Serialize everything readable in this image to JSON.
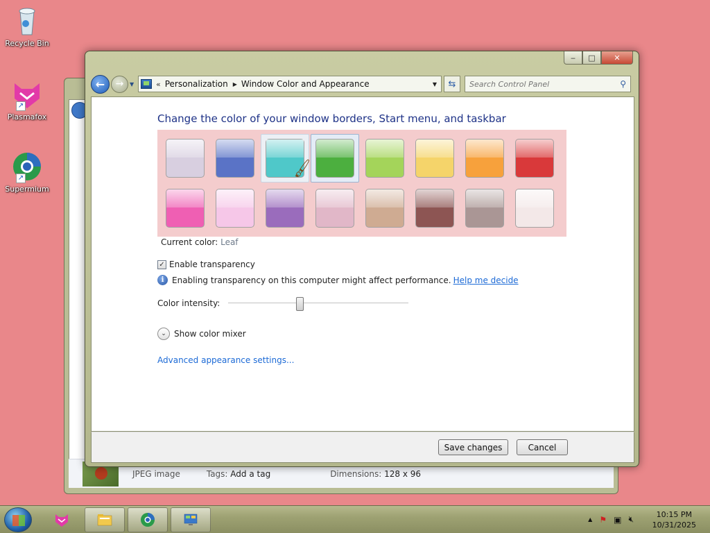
{
  "desktop": {
    "icons": [
      {
        "label": "Recycle Bin"
      },
      {
        "label": "Plasmafox"
      },
      {
        "label": "Supermium"
      }
    ]
  },
  "background_window": {
    "details": {
      "type": "JPEG image",
      "tags_label": "Tags:",
      "tags_value": "Add a tag",
      "dimensions_label": "Dimensions:",
      "dimensions_value": "128 x 96"
    }
  },
  "window": {
    "caption_buttons": {
      "minimize": "‒",
      "maximize": "□",
      "close": "✕"
    },
    "address": {
      "chevron": "«",
      "crumbs": [
        "Personalization",
        "Window Color and Appearance"
      ]
    },
    "search": {
      "placeholder": "Search Control Panel"
    },
    "heading": "Change the color of your window borders, Start menu, and taskbar",
    "swatches": [
      {
        "color": "#d8cfe0",
        "selected": false
      },
      {
        "color": "#5a73c6",
        "selected": false
      },
      {
        "color": "#4fc8c9",
        "selected": false,
        "hover": true
      },
      {
        "color": "#4caf3f",
        "selected": true
      },
      {
        "color": "#a4d45a",
        "selected": false
      },
      {
        "color": "#f5d46a",
        "selected": false
      },
      {
        "color": "#f7a13c",
        "selected": false
      },
      {
        "color": "#d9393a",
        "selected": false
      },
      {
        "color": "#ef5fb3",
        "selected": false
      },
      {
        "color": "#f6c7e8",
        "selected": false
      },
      {
        "color": "#9a6cbc",
        "selected": false
      },
      {
        "color": "#e1b7c8",
        "selected": false
      },
      {
        "color": "#cfab92",
        "selected": false
      },
      {
        "color": "#8d5553",
        "selected": false
      },
      {
        "color": "#aa9695",
        "selected": false
      },
      {
        "color": "#f3e8e8",
        "selected": false
      }
    ],
    "current_color_label": "Current color:",
    "current_color_value": "Leaf",
    "enable_transparency": {
      "label": "Enable transparency",
      "checked": true
    },
    "info": {
      "text": "Enabling transparency on this computer might affect performance.",
      "link": "Help me decide"
    },
    "color_intensity_label": "Color intensity:",
    "color_intensity_value": 0.4,
    "show_color_mixer": "Show color mixer",
    "advanced_link": "Advanced appearance settings...",
    "buttons": {
      "save": "Save changes",
      "cancel": "Cancel"
    }
  },
  "taskbar": {
    "clock": {
      "time": "10:15 PM",
      "date": "10/31/2025"
    },
    "tray_show_hidden": "▲"
  }
}
